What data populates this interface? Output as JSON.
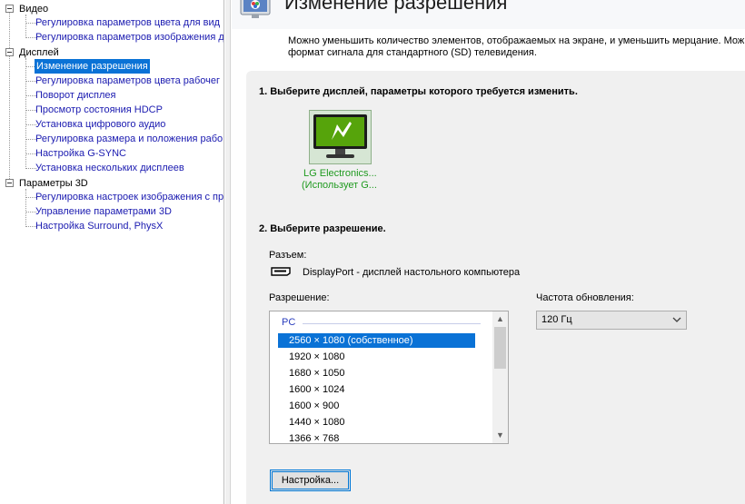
{
  "tree": {
    "categories": [
      {
        "label": "Видео",
        "items": [
          {
            "label": "Регулировка параметров цвета для вид"
          },
          {
            "label": "Регулировка параметров изображения д"
          }
        ]
      },
      {
        "label": "Дисплей",
        "items": [
          {
            "label": "Изменение разрешения"
          },
          {
            "label": "Регулировка параметров цвета рабочег"
          },
          {
            "label": "Поворот дисплея"
          },
          {
            "label": "Просмотр состояния HDCP"
          },
          {
            "label": "Установка цифрового аудио"
          },
          {
            "label": "Регулировка размера и положения рабо"
          },
          {
            "label": "Настройка G-SYNC"
          },
          {
            "label": "Установка нескольких дисплеев"
          }
        ]
      },
      {
        "label": "Параметры 3D",
        "items": [
          {
            "label": "Регулировка настроек изображения с пр"
          },
          {
            "label": "Управление параметрами 3D"
          },
          {
            "label": "Настройка Surround, PhysX"
          }
        ]
      }
    ]
  },
  "page": {
    "title": "Изменение разрешения",
    "description_line1": "Можно уменьшить количество элементов, отображаемых на экране, и уменьшить мерцание. Можно",
    "description_line2": "формат сигнала для стандартного (SD) телевидения."
  },
  "step1": {
    "heading": "1. Выберите дисплей, параметры которого требуется изменить.",
    "monitor": {
      "name": "LG Electronics...",
      "status": "(Использует G..."
    }
  },
  "step2": {
    "heading": "2. Выберите разрешение.",
    "connector_label": "Разъем:",
    "connector_value": "DisplayPort - дисплей настольного компьютера",
    "resolution_label": "Разрешение:",
    "refresh_label": "Частота обновления:",
    "refresh_value": "120 Гц",
    "group_label": "PC",
    "resolutions": [
      "2560 × 1080 (собственное)",
      "1920 × 1080",
      "1680 × 1050",
      "1600 × 1024",
      "1600 × 900",
      "1440 × 1080",
      "1366 × 768"
    ],
    "settings_button": "Настройка..."
  },
  "colors": {
    "selection": "#0a72d6",
    "link": "#1a1ab0",
    "nvidia_green": "#76b900",
    "monitor_label": "#1f9a1f"
  },
  "icons": {
    "tree_toggle": "minus-box-icon",
    "monitor": "nvidia-monitor-icon",
    "connector": "displayport-icon",
    "header": "nvidia-display-icon",
    "scroll_up": "triangle-up-icon",
    "scroll_down": "triangle-down-icon",
    "dropdown": "chevron-down-icon"
  }
}
